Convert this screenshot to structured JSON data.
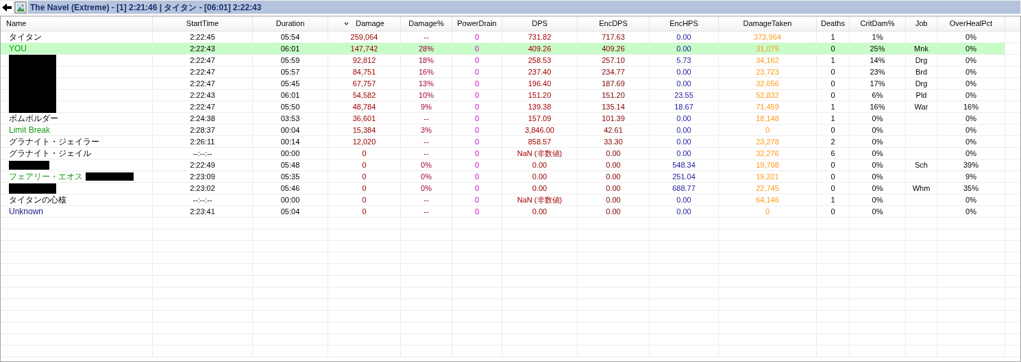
{
  "window": {
    "title": "The Navel (Extreme) - [1] 2:21:46 | タイタン - [06:01] 2:22:43"
  },
  "table": {
    "columns": [
      {
        "label": "Name",
        "sorted": false
      },
      {
        "label": "StartTime",
        "sorted": false
      },
      {
        "label": "Duration",
        "sorted": false
      },
      {
        "label": "Damage",
        "sorted": true
      },
      {
        "label": "Damage%",
        "sorted": false
      },
      {
        "label": "PowerDrain",
        "sorted": false
      },
      {
        "label": "DPS",
        "sorted": false
      },
      {
        "label": "EncDPS",
        "sorted": false
      },
      {
        "label": "EncHPS",
        "sorted": false
      },
      {
        "label": "DamageTaken",
        "sorted": false
      },
      {
        "label": "Deaths",
        "sorted": false
      },
      {
        "label": "CritDam%",
        "sorted": false
      },
      {
        "label": "Job",
        "sorted": false
      },
      {
        "label": "OverHealPct",
        "sorted": false
      }
    ],
    "rows": [
      {
        "selected": false,
        "cells": [
          "タイタン",
          "2:22:45",
          "05:54",
          "259,064",
          "--",
          "0",
          "731.82",
          "717.63",
          "0.00",
          "373,964",
          "1",
          "1%",
          "",
          "0%"
        ]
      },
      {
        "color": "#1a9a1a",
        "selected": true,
        "cells": [
          "YOU",
          "2:22:43",
          "06:01",
          "147,742",
          "28%",
          "0",
          "409.26",
          "409.26",
          "0.00",
          "31,079",
          "0",
          "25%",
          "Mnk",
          "0%"
        ]
      },
      {
        "redacted": true,
        "selected": false,
        "cells": [
          "",
          "2:22:47",
          "05:59",
          "92,812",
          "18%",
          "0",
          "258.53",
          "257.10",
          "5.73",
          "34,162",
          "1",
          "14%",
          "Drg",
          "0%"
        ]
      },
      {
        "redacted": true,
        "selected": false,
        "cells": [
          "",
          "2:22:47",
          "05:57",
          "84,751",
          "16%",
          "0",
          "237.40",
          "234.77",
          "0.00",
          "23,723",
          "0",
          "23%",
          "Brd",
          "0%"
        ]
      },
      {
        "redacted": true,
        "selected": false,
        "cells": [
          "",
          "2:22:47",
          "05:45",
          "67,757",
          "13%",
          "0",
          "196.40",
          "187.69",
          "0.00",
          "32,656",
          "0",
          "17%",
          "Drg",
          "0%"
        ]
      },
      {
        "redacted": true,
        "selected": false,
        "cells": [
          "",
          "2:22:43",
          "06:01",
          "54,582",
          "10%",
          "0",
          "151.20",
          "151.20",
          "23.55",
          "52,832",
          "0",
          "6%",
          "Pld",
          "0%"
        ]
      },
      {
        "redacted": true,
        "selected": false,
        "cells": [
          "",
          "2:22:47",
          "05:50",
          "48,784",
          "9%",
          "0",
          "139.38",
          "135.14",
          "18.67",
          "71,459",
          "1",
          "16%",
          "War",
          "16%"
        ]
      },
      {
        "selected": false,
        "cells": [
          "ボムボルダー",
          "2:24:38",
          "03:53",
          "36,601",
          "--",
          "0",
          "157.09",
          "101.39",
          "0.00",
          "18,148",
          "1",
          "0%",
          "",
          "0%"
        ]
      },
      {
        "color": "#1a9a1a",
        "selected": false,
        "cells": [
          "Limit Break",
          "2:28:37",
          "00:04",
          "15,384",
          "3%",
          "0",
          "3,846.00",
          "42.61",
          "0.00",
          "0",
          "0",
          "0%",
          "",
          "0%"
        ]
      },
      {
        "selected": false,
        "cells": [
          "グラナイト・ジェイラー",
          "2:26:11",
          "00:14",
          "12,020",
          "--",
          "0",
          "858.57",
          "33.30",
          "0.00",
          "23,278",
          "2",
          "0%",
          "",
          "0%"
        ]
      },
      {
        "selected": false,
        "cells": [
          "グラナイト・ジェイル",
          "--:--:--",
          "00:00",
          "0",
          "--",
          "0",
          "NaN (非数値)",
          "0.00",
          "0.00",
          "32,276",
          "6",
          "0%",
          "",
          "0%"
        ]
      },
      {
        "redacted": true,
        "selected": false,
        "cells": [
          "",
          "2:22:49",
          "05:48",
          "0",
          "0%",
          "0",
          "0.00",
          "0.00",
          "548.34",
          "19,708",
          "0",
          "0%",
          "Sch",
          "39%"
        ]
      },
      {
        "color": "#1a9a1a",
        "redacted": true,
        "selected": false,
        "cells": [
          "フェアリー・エオス",
          "2:23:09",
          "05:35",
          "0",
          "0%",
          "0",
          "0.00",
          "0.00",
          "251.04",
          "19,321",
          "0",
          "0%",
          "",
          "9%"
        ]
      },
      {
        "redacted": true,
        "selected": false,
        "cells": [
          "",
          "2:23:02",
          "05:46",
          "0",
          "0%",
          "0",
          "0.00",
          "0.00",
          "688.77",
          "22,745",
          "0",
          "0%",
          "Whm",
          "35%"
        ]
      },
      {
        "selected": false,
        "cells": [
          "タイタンの心核",
          "--:--:--",
          "00:00",
          "0",
          "--",
          "0",
          "NaN (非数値)",
          "0.00",
          "0.00",
          "64,146",
          "1",
          "0%",
          "",
          "0%"
        ]
      },
      {
        "color": "#1a1a80",
        "selected": false,
        "cells": [
          "Unknown",
          "2:23:41",
          "05:04",
          "0",
          "--",
          "0",
          "0.00",
          "0.00",
          "0.00",
          "0",
          "0",
          "0%",
          "",
          "0%"
        ]
      }
    ]
  }
}
